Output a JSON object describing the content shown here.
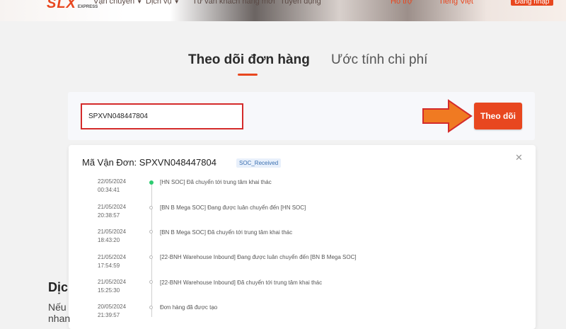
{
  "header": {
    "logo": "SLX",
    "logo_sub": "EXPRESS",
    "nav": [
      {
        "label": "Vận chuyển"
      },
      {
        "label": "Dịch vụ"
      },
      {
        "label": "Tư vấn khách hàng mới"
      },
      {
        "label": "Tuyển dụng"
      }
    ],
    "right": [
      {
        "label": "Hỗ trợ"
      },
      {
        "label": "Tiếng Việt"
      }
    ],
    "login_label": "Đăng nhập"
  },
  "tabs": [
    {
      "label": "Theo dõi đơn hàng",
      "active": true
    },
    {
      "label": "Ước tính chi phí",
      "active": false
    }
  ],
  "search": {
    "value": "SPXVN048447804",
    "button_label": "Theo dõi"
  },
  "result": {
    "waybill_label": "Mã Vận Đơn:",
    "waybill_code": "SPXVN048447804",
    "status": "SOC_Received",
    "events": [
      {
        "date": "22/05/2024",
        "time": "00:34:41",
        "desc": "[HN SOC] Đã chuyển tới trung tâm khai thác"
      },
      {
        "date": "21/05/2024",
        "time": "20:38:57",
        "desc": "[BN B Mega SOC] Đang được luân chuyển đến [HN SOC]"
      },
      {
        "date": "21/05/2024",
        "time": "18:43:20",
        "desc": "[BN B Mega SOC] Đã chuyển tới trung tâm khai thác"
      },
      {
        "date": "21/05/2024",
        "time": "17:54:59",
        "desc": "[22-BNH Warehouse Inbound] Đang được luân chuyển đến [BN B Mega SOC]"
      },
      {
        "date": "21/05/2024",
        "time": "15:25:30",
        "desc": "[22-BNH Warehouse Inbound] Đã chuyển tới trung tâm khai thác"
      },
      {
        "date": "20/05/2024",
        "time": "21:39:57",
        "desc": "Đơn hàng đã được tạo"
      }
    ]
  },
  "background": {
    "heading": "Dịc",
    "line1": "Nếu",
    "line2": "nhan"
  },
  "colors": {
    "accent": "#e8471f",
    "highlight_border": "#d42b2b",
    "active_dot": "#2ecc71"
  }
}
